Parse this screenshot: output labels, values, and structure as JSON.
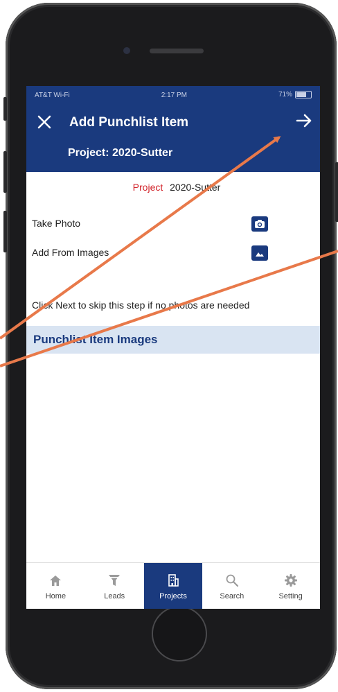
{
  "status_bar": {
    "carrier": "AT&T Wi-Fi",
    "time": "2:17 PM",
    "battery": "71%"
  },
  "header": {
    "title": "Add Punchlist Item",
    "subtitle": "Project: 2020-Sutter",
    "close_icon": "close-icon",
    "next_icon": "arrow-right-icon"
  },
  "project": {
    "label": "Project",
    "value": "2020-Sutter"
  },
  "options": [
    {
      "label": "Take Photo",
      "icon": "camera-icon"
    },
    {
      "label": "Add From Images",
      "icon": "image-icon"
    }
  ],
  "hint": "Click Next to skip this step if no photos are needed",
  "images_section": {
    "title": "Punchlist Item Images"
  },
  "tabbar": {
    "items": [
      {
        "label": "Home",
        "icon": "home-icon",
        "active": false
      },
      {
        "label": "Leads",
        "icon": "funnel-icon",
        "active": false
      },
      {
        "label": "Projects",
        "icon": "building-icon",
        "active": true
      },
      {
        "label": "Search",
        "icon": "search-icon",
        "active": false
      },
      {
        "label": "Setting",
        "icon": "gear-icon",
        "active": false
      }
    ]
  },
  "colors": {
    "brand": "#1a3a7e",
    "accent_red": "#d2232a",
    "section_bg": "#d9e4f2",
    "annotation_arrow": "#e8794a"
  }
}
